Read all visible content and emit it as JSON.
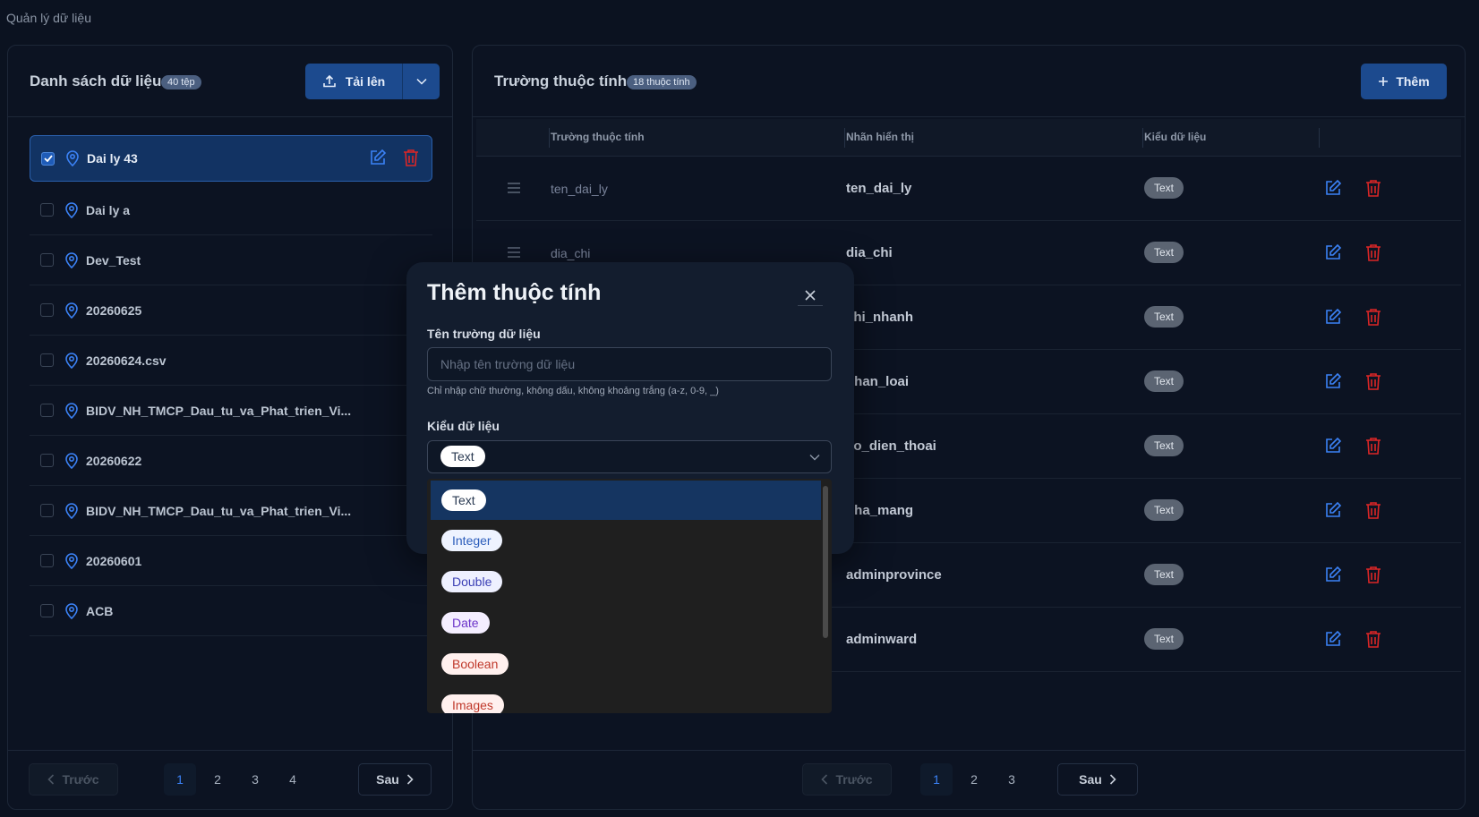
{
  "page": {
    "title": "Quản lý dữ liệu"
  },
  "left_panel": {
    "title": "Danh sách dữ liệu",
    "badge": "40 tệp",
    "upload_label": "Tải lên",
    "files": [
      {
        "name": "Dai ly 43",
        "selected": true
      },
      {
        "name": "Dai ly a",
        "selected": false
      },
      {
        "name": "Dev_Test",
        "selected": false
      },
      {
        "name": "20260625",
        "selected": false
      },
      {
        "name": "20260624.csv",
        "selected": false
      },
      {
        "name": "BIDV_NH_TMCP_Dau_tu_va_Phat_trien_Vi...",
        "selected": false
      },
      {
        "name": "20260622",
        "selected": false
      },
      {
        "name": "BIDV_NH_TMCP_Dau_tu_va_Phat_trien_Vi...",
        "selected": false
      },
      {
        "name": "20260601",
        "selected": false
      },
      {
        "name": "ACB",
        "selected": false
      }
    ],
    "pager": {
      "prev": "Trước",
      "next": "Sau",
      "pages": [
        "1",
        "2",
        "3",
        "4"
      ],
      "current": "1"
    }
  },
  "right_panel": {
    "title": "Trường thuộc tính",
    "badge": "18 thuộc tính",
    "add_label": "Thêm",
    "columns": {
      "field": "Trường thuộc tính",
      "label": "Nhãn hiển thị",
      "type": "Kiểu dữ liệu"
    },
    "rows": [
      {
        "field": "ten_dai_ly",
        "label": "ten_dai_ly",
        "type": "Text"
      },
      {
        "field": "dia_chi",
        "label": "dia_chi",
        "type": "Text"
      },
      {
        "field": "",
        "label": "chi_nhanh",
        "type": "Text"
      },
      {
        "field": "",
        "label": "phan_loai",
        "type": "Text"
      },
      {
        "field": "",
        "label": "so_dien_thoai",
        "type": "Text"
      },
      {
        "field": "",
        "label": "nha_mang",
        "type": "Text"
      },
      {
        "field": "",
        "label": "adminprovince",
        "type": "Text"
      },
      {
        "field": "",
        "label": "adminward",
        "type": "Text"
      }
    ],
    "pager": {
      "prev": "Trước",
      "next": "Sau",
      "pages": [
        "1",
        "2",
        "3"
      ],
      "current": "1"
    }
  },
  "modal": {
    "title": "Thêm thuộc tính",
    "name_label": "Tên trường dữ liệu",
    "name_placeholder": "Nhập tên trường dữ liệu",
    "name_value": "",
    "hint": "Chỉ nhập chữ thường, không dấu, không khoảng trắng (a-z, 0-9, _)",
    "type_label": "Kiểu dữ liệu",
    "type_selected": "Text",
    "type_options": [
      "Text",
      "Integer",
      "Double",
      "Date",
      "Boolean",
      "Images"
    ]
  },
  "colors": {
    "accent": "#1c4a8e",
    "danger": "#dc2626",
    "link": "#3b82f6"
  }
}
